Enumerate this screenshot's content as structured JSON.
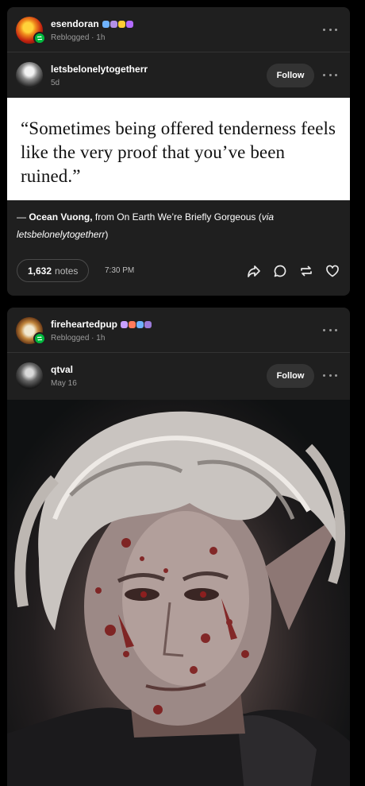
{
  "posts": [
    {
      "reblogger": {
        "username": "esendoran",
        "meta": "Reblogged · 1h",
        "badges": [
          "#6fb3ff",
          "#b38fe6",
          "#ffcc33",
          "#b36bff"
        ]
      },
      "author": {
        "username": "letsbelonelytogetherr",
        "meta": "5d",
        "follow_label": "Follow"
      },
      "quote": "“Sometimes being offered tenderness feels like the very proof that you’ve been ruined.”",
      "caption": {
        "dash": "— ",
        "author": "Ocean Vuong,",
        "source": " from On Earth We’re Briefly Gorgeous (",
        "via": "via letsbelonelytogetherr",
        "close": ")"
      },
      "footer": {
        "notes_count": "1,632",
        "notes_label": "notes",
        "time": "7:30 PM"
      }
    },
    {
      "reblogger": {
        "username": "fireheartedpup",
        "meta": "Reblogged · 1h",
        "badges": [
          "#c8a0ff",
          "#ff7a5a",
          "#6fb3ff",
          "#9b7bd8"
        ]
      },
      "author": {
        "username": "qtval",
        "meta": "May 16",
        "follow_label": "Follow"
      }
    }
  ],
  "colors": {
    "background": "#000000",
    "card": "#1f1f1f",
    "reblog_green": "#00b83d",
    "muted_text": "#9b9b9b"
  },
  "icons": [
    "reblog-badge-icon",
    "more-options-icon",
    "share-icon",
    "reply-icon",
    "reblog-icon",
    "like-icon"
  ]
}
